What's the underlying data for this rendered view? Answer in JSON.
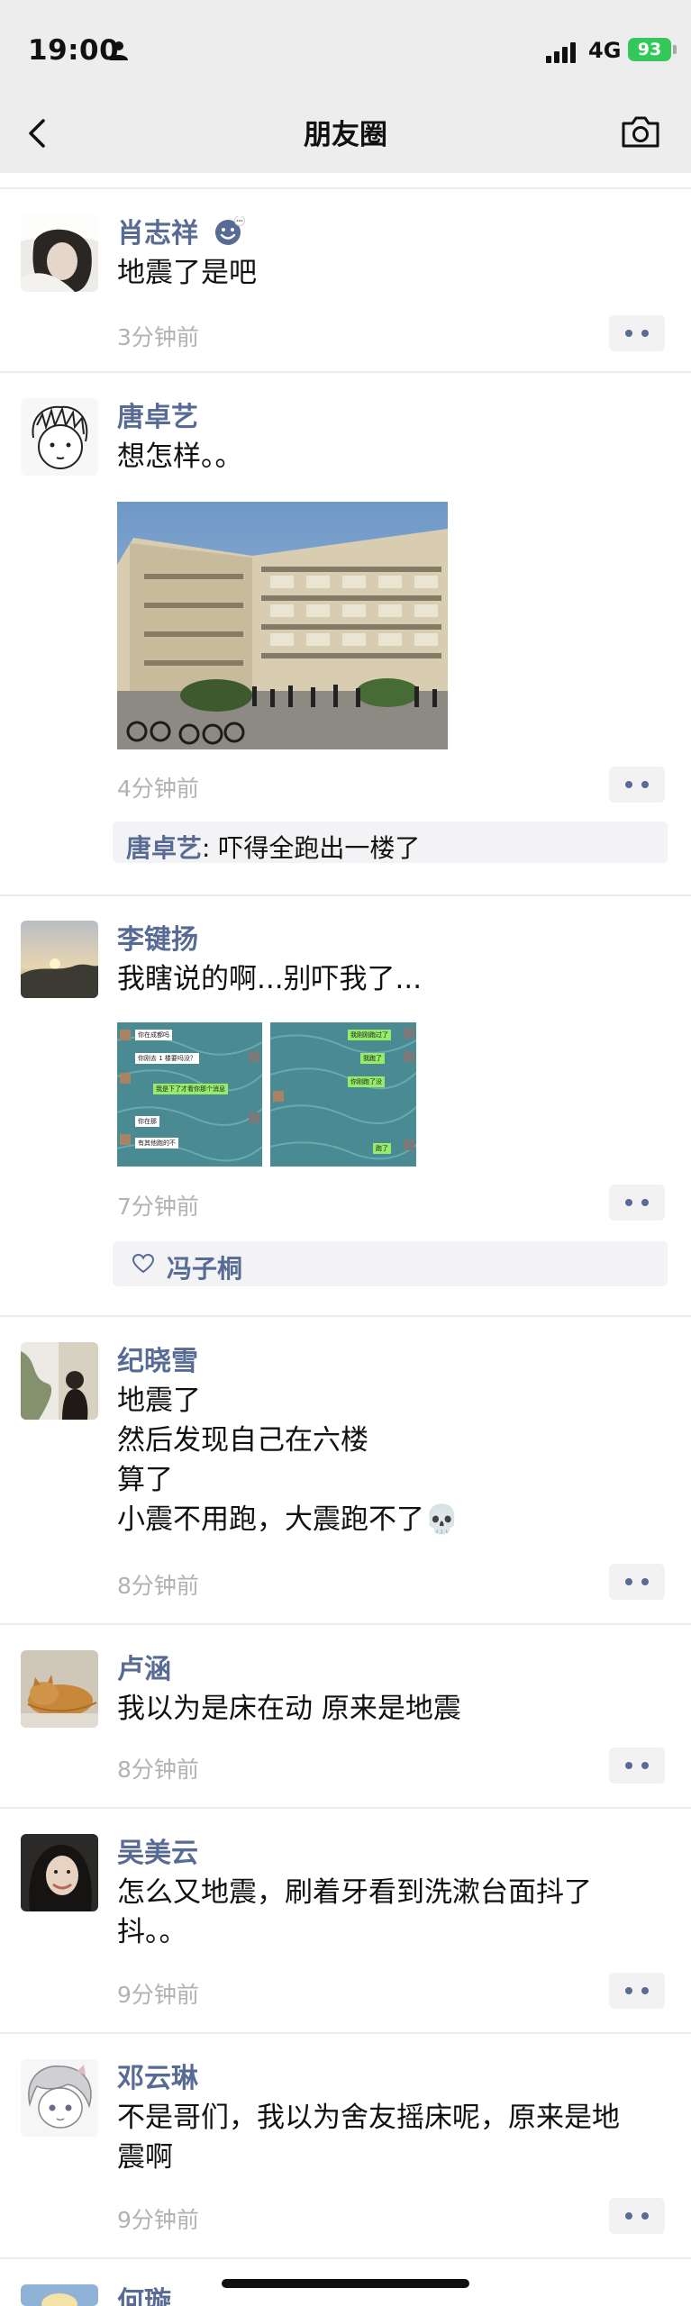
{
  "status_bar": {
    "time": "19:00",
    "network": "4G",
    "battery": "93"
  },
  "nav": {
    "title": "朋友圈"
  },
  "posts": [
    {
      "name": "肖志祥",
      "text": "地震了是吧",
      "time": "3分钟前"
    },
    {
      "name": "唐卓艺",
      "text": "想怎样。。",
      "time": "4分钟前",
      "comment": {
        "name": "唐卓艺",
        "text": ": 吓得全跑出一楼了"
      }
    },
    {
      "name": "李键扬",
      "text": "我瞎说的啊...别吓我了...",
      "time": "7分钟前",
      "likes": "冯子桐",
      "chat_bubbles_left": [
        "你在成都吗",
        "你刚去 1 楼要吗没？",
        "我是下了才看你那个消息",
        "你在那",
        "有其他跑的不"
      ],
      "chat_bubbles_right": [
        "我刚刚跑过了",
        "我跑了",
        "你刚跑了没",
        "跑了"
      ]
    },
    {
      "name": "纪晓雪",
      "lines": [
        "地震了",
        "然后发现自己在六楼",
        "算了",
        "小震不用跑，大震跑不了💀"
      ],
      "time": "8分钟前"
    },
    {
      "name": "卢涵",
      "text": "我以为是床在动 原来是地震",
      "time": "8分钟前"
    },
    {
      "name": "吴美云",
      "lines": [
        "怎么又地震，刷着牙看到洗漱台面抖了",
        "抖。。"
      ],
      "time": "9分钟前"
    },
    {
      "name": "邓云琳",
      "lines": [
        "不是哥们，我以为舍友摇床呢，原来是地",
        "震啊"
      ],
      "time": "9分钟前"
    },
    {
      "name": "何璇"
    }
  ]
}
